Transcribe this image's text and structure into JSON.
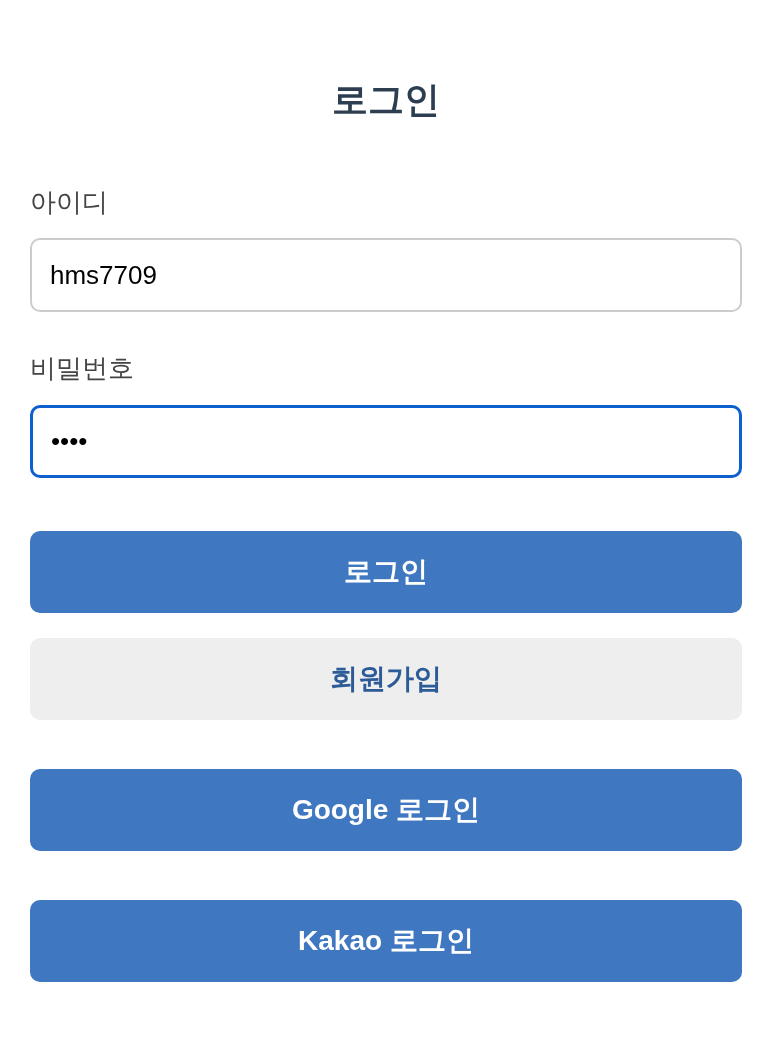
{
  "title": "로그인",
  "fields": [
    {
      "label": "아이디",
      "value": "hms7709",
      "focused": false
    },
    {
      "label": "비밀번호",
      "value": "••••",
      "focused": true
    }
  ],
  "buttons": [
    {
      "label": "로그인",
      "kind": "primary"
    },
    {
      "label": "회원가입",
      "kind": "secondary"
    }
  ],
  "social_buttons": [
    {
      "label": "Google 로그인",
      "kind": "primary"
    },
    {
      "label": "Kakao 로그인",
      "kind": "primary"
    }
  ]
}
